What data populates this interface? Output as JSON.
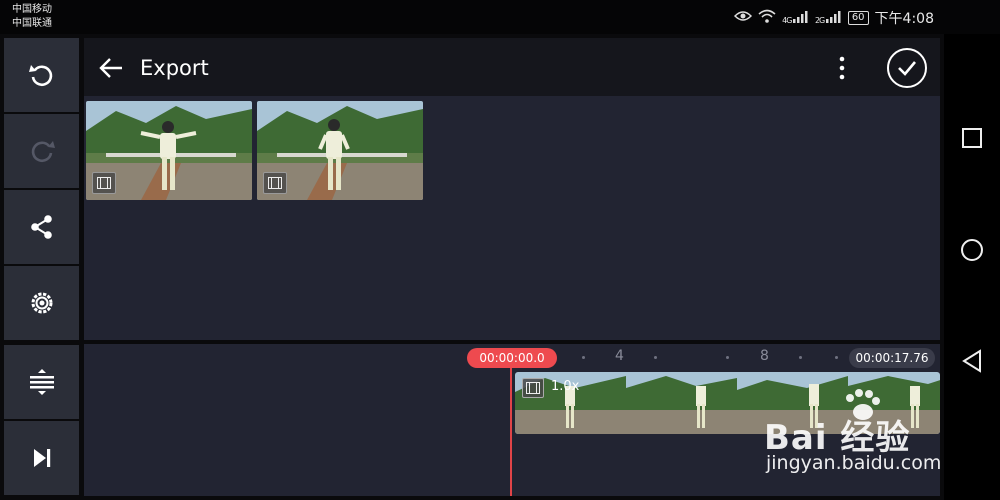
{
  "status_bar": {
    "carrier_1": "中国移动",
    "carrier_2": "中国联通",
    "network_1": "4G",
    "network_2": "2G",
    "battery": "60",
    "time": "下午4:08"
  },
  "header": {
    "title": "Export"
  },
  "toolbar": {
    "items": [
      "undo-icon",
      "redo-icon",
      "share-icon",
      "settings-icon",
      "track-adjust-icon",
      "skip-to-end-icon"
    ]
  },
  "media": {
    "clips": [
      {
        "type": "video"
      },
      {
        "type": "video"
      }
    ]
  },
  "timeline": {
    "playhead_time": "00:00:00.0",
    "total_duration": "00:00:17.76",
    "ruler_labels": [
      "4",
      "8"
    ],
    "clip_speed": "1.0x"
  },
  "watermark": {
    "logo_text": "Bai 经验",
    "url": "jingyan.baidu.com"
  },
  "colors": {
    "accent": "#ee4a4f",
    "panel": "#222432",
    "toolbar": "#2b2e38"
  }
}
